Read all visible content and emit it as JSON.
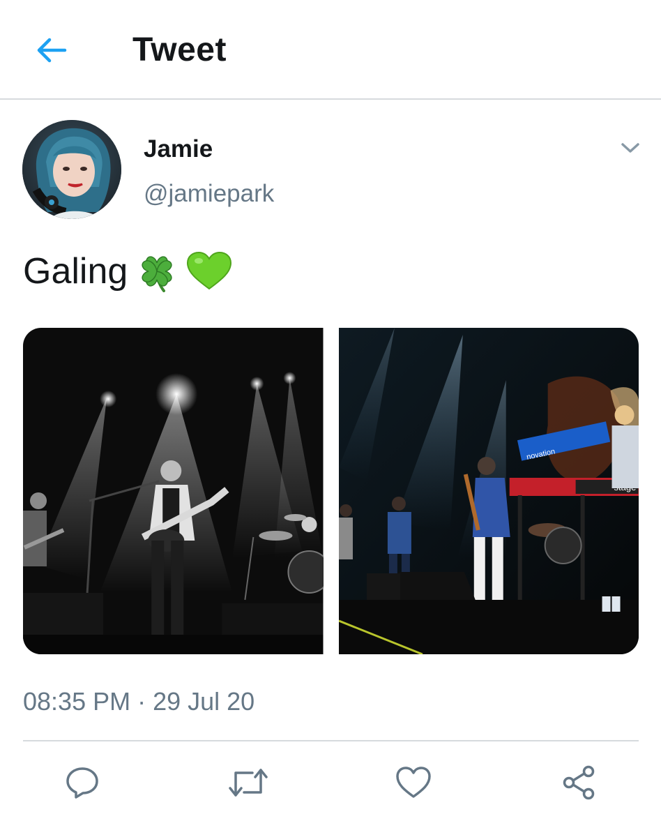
{
  "header": {
    "title": "Tweet",
    "back_icon": "arrow-left-icon",
    "accent_color": "#1da1f2"
  },
  "author": {
    "display_name": "Jamie",
    "handle": "@jamiepark",
    "menu_icon": "chevron-down-icon"
  },
  "tweet": {
    "text": "Galing",
    "emojis": [
      "four-leaf-clover-emoji",
      "green-heart-emoji"
    ],
    "media_count": 2,
    "timestamp": "08:35 PM · 29 Jul 20"
  },
  "actions": [
    {
      "name": "reply",
      "icon": "reply-icon"
    },
    {
      "name": "retweet",
      "icon": "retweet-icon"
    },
    {
      "name": "like",
      "icon": "heart-icon"
    },
    {
      "name": "share",
      "icon": "share-icon"
    }
  ],
  "colors": {
    "text_primary": "#14171a",
    "text_secondary": "#657786",
    "divider": "#d6dadd",
    "icon": "#657786"
  }
}
